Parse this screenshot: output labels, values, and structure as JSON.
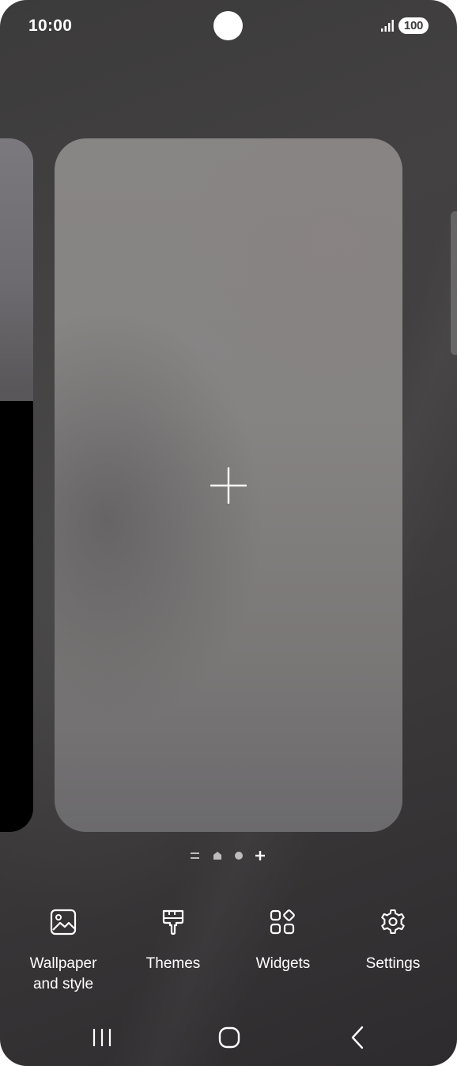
{
  "status_bar": {
    "time": "10:00",
    "battery": "100",
    "signal_icon": "signal-bars-icon"
  },
  "pages": {
    "main_page_icon": "plus-icon",
    "indicator": [
      {
        "name": "page-indicator-discover",
        "icon": "double-line-icon"
      },
      {
        "name": "page-indicator-home",
        "icon": "home-icon"
      },
      {
        "name": "page-indicator-page",
        "icon": "dot-icon"
      },
      {
        "name": "page-indicator-add",
        "icon": "plus-icon"
      }
    ]
  },
  "edit_menu": {
    "wallpaper": {
      "label_line1": "Wallpaper",
      "label_line2": "and style",
      "icon": "image-icon"
    },
    "themes": {
      "label": "Themes",
      "icon": "paintbrush-icon"
    },
    "widgets": {
      "label": "Widgets",
      "icon": "widgets-icon"
    },
    "settings": {
      "label": "Settings",
      "icon": "gear-icon"
    }
  },
  "nav_bar": {
    "recents_icon": "recents-icon",
    "home_icon": "home-outline-icon",
    "back_icon": "back-chevron-icon"
  },
  "colors": {
    "foreground": "#ffffff",
    "background_dark": "#3c3b3b",
    "page_card": "#858282"
  }
}
